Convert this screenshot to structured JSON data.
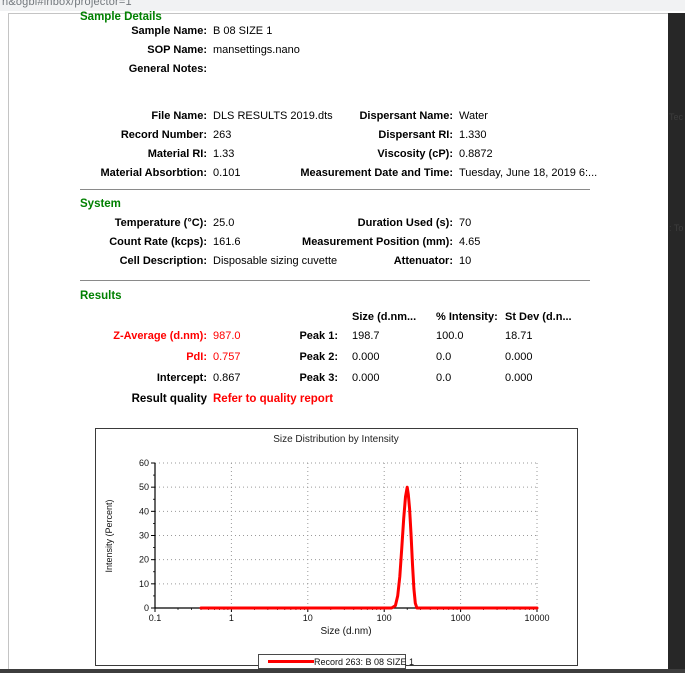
{
  "browser": {
    "url_fragment": "n&ogbl#inbox/projector=1"
  },
  "side_panel": {
    "fragments": [
      "Tec",
      ": To"
    ]
  },
  "colors": {
    "accent_green": "#008000",
    "accent_red": "#ff0000"
  },
  "report": {
    "sample": {
      "title": "Sample Details",
      "rows": [
        {
          "label": "Sample Name:",
          "value": "B 08 SIZE 1"
        },
        {
          "label": "SOP Name:",
          "value": "mansettings.nano"
        },
        {
          "label": "General Notes:",
          "value": ""
        }
      ]
    },
    "file": {
      "left": [
        {
          "label": "File Name:",
          "value": "DLS RESULTS 2019.dts"
        },
        {
          "label": "Record Number:",
          "value": "263"
        },
        {
          "label": "Material RI:",
          "value": "1.33"
        },
        {
          "label": "Material Absorbtion:",
          "value": "0.101"
        }
      ],
      "right": [
        {
          "label": "Dispersant Name:",
          "value": "Water"
        },
        {
          "label": "Dispersant RI:",
          "value": "1.330"
        },
        {
          "label": "Viscosity (cP):",
          "value": "0.8872"
        },
        {
          "label": "Measurement Date and Time:",
          "value": "Tuesday, June 18, 2019 6:..."
        }
      ]
    },
    "system": {
      "title": "System",
      "left": [
        {
          "label": "Temperature (°C):",
          "value": "25.0"
        },
        {
          "label": "Count Rate (kcps):",
          "value": "161.6"
        },
        {
          "label": "Cell Description:",
          "value": "Disposable sizing cuvette"
        }
      ],
      "right": [
        {
          "label": "Duration Used (s):",
          "value": "70"
        },
        {
          "label": "Measurement Position (mm):",
          "value": "4.65"
        },
        {
          "label": "Attenuator:",
          "value": "10"
        }
      ]
    },
    "results": {
      "title": "Results",
      "columns": [
        "Size (d.nm...",
        "% Intensity:",
        "St Dev (d.n..."
      ],
      "left": [
        {
          "label": "Z-Average (d.nm):",
          "value": "987.0"
        },
        {
          "label": "PdI:",
          "value": "0.757"
        },
        {
          "label": "Intercept:",
          "value": "0.867"
        }
      ],
      "peaks": [
        {
          "label": "Peak 1:",
          "size": "198.7",
          "intensity": "100.0",
          "stdev": "18.71"
        },
        {
          "label": "Peak 2:",
          "size": "0.000",
          "intensity": "0.0",
          "stdev": "0.000"
        },
        {
          "label": "Peak 3:",
          "size": "0.000",
          "intensity": "0.0",
          "stdev": "0.000"
        }
      ],
      "quality_label": "Result quality",
      "quality_value": "Refer to quality report"
    }
  },
  "chart_data": {
    "type": "line",
    "title": "Size Distribution by Intensity",
    "xlabel": "Size (d.nm)",
    "ylabel": "Intensity (Percent)",
    "x_scale": "log",
    "xlim": [
      0.1,
      10000
    ],
    "ylim": [
      0,
      60
    ],
    "x_ticks": [
      0.1,
      1,
      10,
      100,
      1000,
      10000
    ],
    "y_ticks": [
      0,
      10,
      20,
      30,
      40,
      50,
      60
    ],
    "grid": "dotted",
    "legend_position": "bottom",
    "series": [
      {
        "name": "Record 263: B 08 SIZE 1",
        "color": "#ff0000",
        "points": [
          [
            0.4,
            0
          ],
          [
            50,
            0
          ],
          [
            100,
            0
          ],
          [
            125,
            0
          ],
          [
            140,
            1
          ],
          [
            150,
            5
          ],
          [
            160,
            13
          ],
          [
            170,
            25
          ],
          [
            180,
            37
          ],
          [
            190,
            46
          ],
          [
            200,
            50
          ],
          [
            207,
            47
          ],
          [
            215,
            41
          ],
          [
            225,
            30
          ],
          [
            235,
            18
          ],
          [
            245,
            8
          ],
          [
            255,
            2
          ],
          [
            268,
            0
          ],
          [
            500,
            0
          ],
          [
            1000,
            0
          ],
          [
            10000,
            0
          ]
        ]
      }
    ]
  }
}
